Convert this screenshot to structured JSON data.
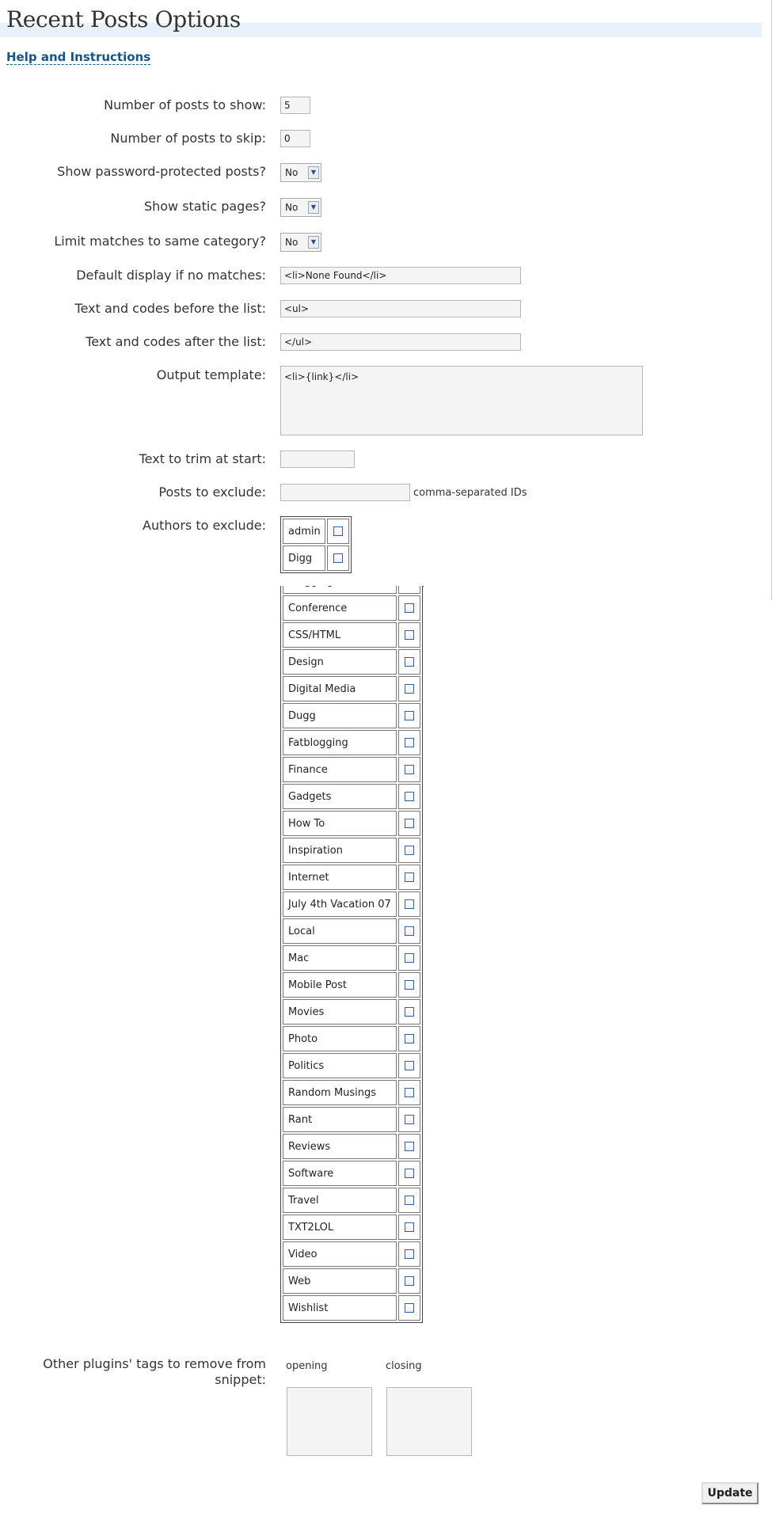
{
  "page": {
    "title": "Recent Posts Options",
    "help_link": "Help and Instructions"
  },
  "fields": {
    "num_posts": {
      "label": "Number of posts to show:",
      "value": "5"
    },
    "skip_posts": {
      "label": "Number of posts to skip:",
      "value": "0"
    },
    "show_protected": {
      "label": "Show password-protected posts?",
      "value": "No"
    },
    "show_static": {
      "label": "Show static pages?",
      "value": "No"
    },
    "limit_category": {
      "label": "Limit matches to same category?",
      "value": "No"
    },
    "none_text": {
      "label": "Default display if no matches:",
      "value": "<li>None Found</li>"
    },
    "prefix": {
      "label": "Text and codes before the list:",
      "value": "<ul>"
    },
    "suffix": {
      "label": "Text and codes after the list:",
      "value": "</ul>"
    },
    "output_template": {
      "label": "Output template:",
      "value": "<li>{link}</li>"
    },
    "trim_start": {
      "label": "Text to trim at start:",
      "value": ""
    },
    "exclude_posts": {
      "label": "Posts to exclude:",
      "value": "",
      "hint": "comma-separated IDs"
    },
    "exclude_authors": {
      "label": "Authors to exclude:"
    },
    "strip_tags": {
      "label": "Other plugins' tags to remove from snippet:",
      "opening_label": "opening",
      "closing_label": "closing"
    }
  },
  "authors": [
    "admin",
    "Digg"
  ],
  "categories": [
    "Blogging",
    "Conference",
    "CSS/HTML",
    "Design",
    "Digital Media",
    "Dugg",
    "Fatblogging",
    "Finance",
    "Gadgets",
    "How To",
    "Inspiration",
    "Internet",
    "July 4th Vacation 07",
    "Local",
    "Mac",
    "Mobile Post",
    "Movies",
    "Photo",
    "Politics",
    "Random Musings",
    "Rant",
    "Reviews",
    "Software",
    "Travel",
    "TXT2LOL",
    "Video",
    "Web",
    "Wishlist"
  ],
  "buttons": {
    "update": "Update"
  },
  "colors": {
    "title_bar": "#e6f1fb",
    "link": "#14568a",
    "field_bg": "#f4f4f4"
  }
}
